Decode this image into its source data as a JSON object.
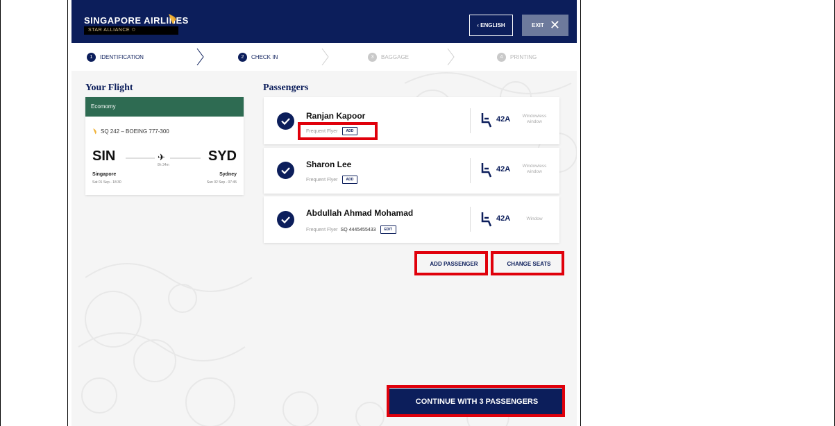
{
  "header": {
    "airline": "SINGAPORE AIRLINES",
    "alliance": "STAR ALLIANCE ✩",
    "language_label": "‹ ENGLISH",
    "exit_label": "EXIT",
    "exit_icon": "close-icon"
  },
  "steps": [
    {
      "num": "1",
      "label": "IDENTIFICATION",
      "state": "done"
    },
    {
      "num": "2",
      "label": "CHECK IN",
      "state": "active"
    },
    {
      "num": "3",
      "label": "BAGGAGE",
      "state": "inactive"
    },
    {
      "num": "4",
      "label": "PRINTING",
      "state": "inactive"
    }
  ],
  "flight": {
    "title": "Your Flight",
    "cabin": "Ecomomy",
    "flight_number": "SQ 242 – BOEING 777-300",
    "origin_code": "SIN",
    "destination_code": "SYD",
    "duration": "8h 34m",
    "origin_city": "Singapore",
    "origin_datetime": "Sat 01 Sep - 18:30",
    "destination_city": "Sydney",
    "destination_datetime": "Sun 02 Sep - 07:45"
  },
  "passengers": {
    "title": "Passengers",
    "items": [
      {
        "name": "Ranjan Kapoor",
        "ff_label": "Frequent Flyer",
        "ff_number": "",
        "action": "ADD",
        "seat": "42A",
        "seat_type": "Windowless window",
        "checked": true
      },
      {
        "name": "Sharon Lee",
        "ff_label": "Frequent Flyer",
        "ff_number": "",
        "action": "ADD",
        "seat": "42A",
        "seat_type": "Windowless window",
        "checked": true
      },
      {
        "name": "Abdullah Ahmad Mohamad",
        "ff_label": "Frequent Flyer",
        "ff_number": "SQ 4445455433",
        "action": "EDIT",
        "seat": "42A",
        "seat_type": "Window",
        "checked": true
      }
    ]
  },
  "actions": {
    "add_passenger": "ADD PASSENGER",
    "change_seats": "CHANGE SEATS",
    "continue": "CONTINUE WITH 3 PASSENGERS"
  },
  "colors": {
    "brand_navy": "#0c1e5b",
    "cabin_green": "#2e6b52",
    "highlight_red": "#e0000b"
  }
}
